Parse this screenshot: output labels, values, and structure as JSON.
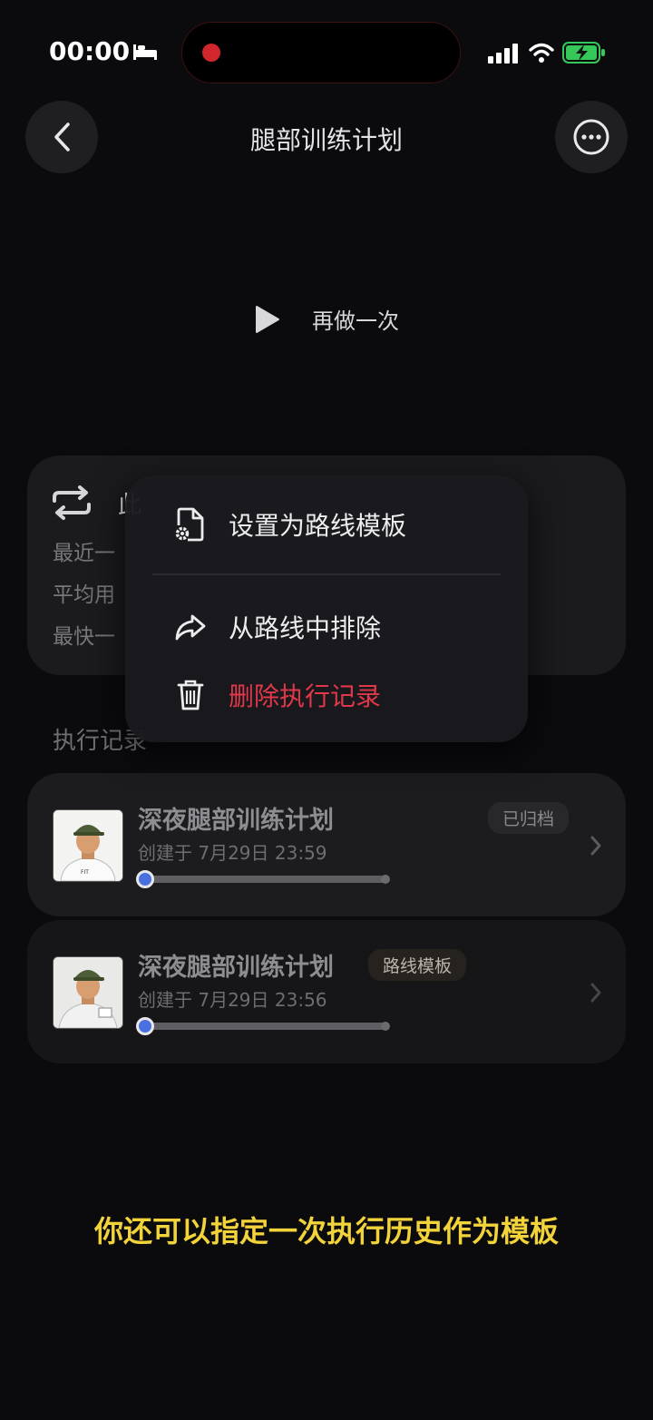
{
  "status_bar": {
    "time": "00:00"
  },
  "nav": {
    "title": "腿部训练计划"
  },
  "redo": {
    "label": "再做一次"
  },
  "stats": {
    "title_partial": "此",
    "lines": [
      "最近一",
      "平均用",
      "最快一"
    ]
  },
  "section": {
    "title": "执行记录"
  },
  "records": [
    {
      "name": "深夜腿部训练计划",
      "date": "创建于 7月29日 23:59",
      "badge": "已归档",
      "progress": 0.0
    },
    {
      "name": "深夜腿部训练计划",
      "date": "创建于 7月29日 23:56",
      "badge": "路线模板",
      "progress": 0.0
    }
  ],
  "context_menu": {
    "items": [
      {
        "label": "设置为路线模板",
        "icon": "doc-gear-icon"
      },
      {
        "label": "从路线中排除",
        "icon": "share-arrow-icon"
      },
      {
        "label": "删除执行记录",
        "icon": "trash-icon",
        "danger": true
      }
    ]
  },
  "caption": "你还可以指定一次执行历史作为模板",
  "colors": {
    "accent_blue": "#4a6fe0",
    "danger": "#e0384a",
    "caption": "#f2d33a",
    "battery": "#35c759"
  }
}
